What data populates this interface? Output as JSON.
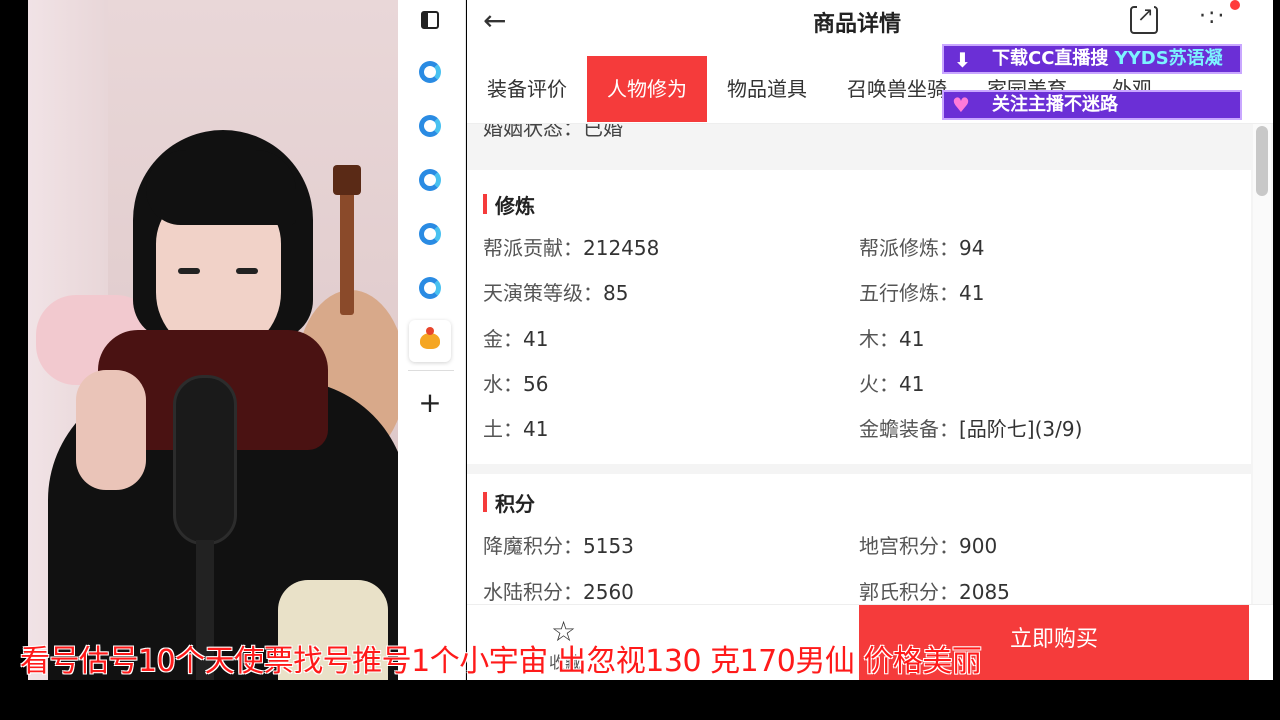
{
  "header": {
    "title": "商品详情"
  },
  "tabs": [
    {
      "label": "装备评价"
    },
    {
      "label": "人物修为"
    },
    {
      "label": "物品道具"
    },
    {
      "label": "召唤兽坐骑"
    },
    {
      "label": "家园美育"
    },
    {
      "label": "外观"
    }
  ],
  "cut_text": "婚姻状态：已婚",
  "section_cultivation": {
    "title": "修炼",
    "items": [
      {
        "label": "帮派贡献：",
        "value": "212458"
      },
      {
        "label": "帮派修炼：",
        "value": "94"
      },
      {
        "label": "天演策等级：",
        "value": "85"
      },
      {
        "label": "五行修炼：",
        "value": "41"
      },
      {
        "label": "金：",
        "value": "41"
      },
      {
        "label": "木：",
        "value": "41"
      },
      {
        "label": "水：",
        "value": "56"
      },
      {
        "label": "火：",
        "value": "41"
      },
      {
        "label": "土：",
        "value": "41"
      },
      {
        "label": "金蟾装备：",
        "value": "[品阶七](3/9)"
      }
    ]
  },
  "section_points": {
    "title": "积分",
    "items": [
      {
        "label": "降魔积分：",
        "value": "5153"
      },
      {
        "label": "地宫积分：",
        "value": "900"
      },
      {
        "label": "水陆积分：",
        "value": "2560"
      },
      {
        "label": "郭氏积分：",
        "value": "2085"
      }
    ]
  },
  "bottom_bar": {
    "fav_label": "收藏",
    "buy_label": "立即购买"
  },
  "overlays": {
    "banner1_prefix": "下载CC直播搜 ",
    "banner1_highlight": "YYDS苏语凝",
    "banner2": "关注主播不迷路",
    "ticker": "看号估号10个天使票找号推号1个小宇宙 出忽视130  克170男仙 价格美丽"
  },
  "colors": {
    "accent": "#f53b3b",
    "banner_bg": "#6b2fd6",
    "ticker": "#ff1a1a"
  }
}
